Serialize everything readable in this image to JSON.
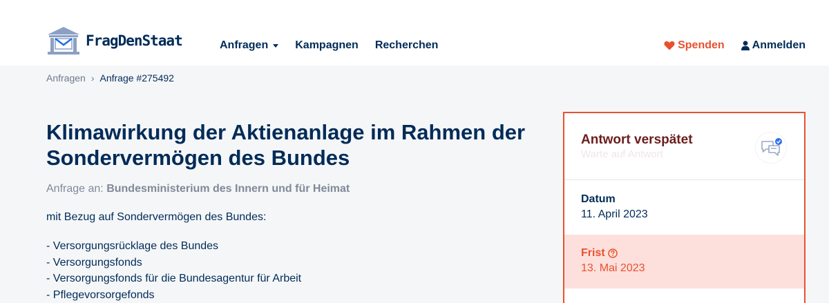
{
  "header": {
    "logo_text": "FragDenStaat",
    "nav": [
      {
        "label": "Anfragen",
        "has_dropdown": true
      },
      {
        "label": "Kampagnen",
        "has_dropdown": false
      },
      {
        "label": "Recherchen",
        "has_dropdown": false
      }
    ],
    "donate_label": "Spenden",
    "login_label": "Anmelden"
  },
  "breadcrumb": {
    "parent": "Anfragen",
    "separator": "›",
    "current": "Anfrage #275492"
  },
  "request": {
    "title": "Klimawirkung der Aktienanlage im Rahmen der Sondervermögen des Bundes",
    "recipient_prefix": "Anfrage an:",
    "recipient": "Bundesministerium des Innern und für Heimat",
    "intro": "mit Bezug auf Sondervermögen des Bundes:",
    "items": [
      "- Versorgungsrücklage des Bundes",
      "- Versorgungsfonds",
      "- Versorgungsfonds für die Bundesagentur für Arbeit",
      "- Pflegevorsorgefonds"
    ]
  },
  "status": {
    "title": "Antwort verspätet",
    "subtitle": "Warte auf Antwort",
    "date_label": "Datum",
    "date_value": "11. April 2023",
    "deadline_label": "Frist",
    "deadline_value": "13. Mai 2023"
  },
  "colors": {
    "brand": "#002b58",
    "accent": "#e8512f",
    "deadline_bg": "#fde0dc"
  },
  "icons": {
    "logo": "building-mail-icon",
    "donate": "heart-icon",
    "login": "user-icon",
    "status": "chat-bubble-icon",
    "deadline_help": "question-circle-icon"
  }
}
